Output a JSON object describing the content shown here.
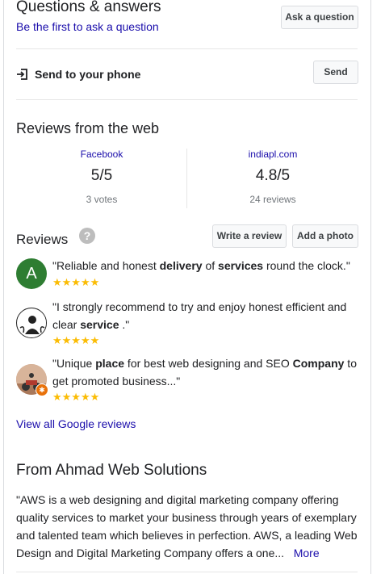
{
  "qa": {
    "title": "Questions & answers",
    "subtitle": "Be the first to ask a question",
    "ask_button": "Ask a question"
  },
  "send": {
    "label": "Send to your phone",
    "button": "Send"
  },
  "web_reviews": {
    "title": "Reviews from the web",
    "sources": [
      {
        "name": "Facebook",
        "score": "5/5",
        "count": "3 votes"
      },
      {
        "name": "indiapl.com",
        "score": "4.8/5",
        "count": "24 reviews"
      }
    ]
  },
  "reviews": {
    "title": "Reviews",
    "help_icon": "?",
    "write_button": "Write a review",
    "photo_button": "Add a photo",
    "stars": "★★★★★",
    "avatar_initial": "A",
    "avatar_color": "#2e7d32",
    "star_color": "#fbbc04",
    "items": [
      {
        "parts": [
          "\"Reliable and honest ",
          "delivery",
          " of ",
          "services",
          " round the clock.\""
        ]
      },
      {
        "parts": [
          "\"I strongly recommend to try and enjoy honest efficient and clear ",
          "service",
          " .\""
        ]
      },
      {
        "parts": [
          "\"Unique ",
          "place",
          " for best web designing and SEO ",
          "Company",
          " to get promoted business...\""
        ]
      }
    ],
    "view_all": "View all Google reviews"
  },
  "from": {
    "title": "From Ahmad Web Solutions",
    "text": "\"AWS is a web designing and digital marketing company offering quality services to market your business through years of exemplary and talented team which believes in perfection. AWS, a leading Web Design and Digital Marketing Company offers a one...",
    "more": "More"
  }
}
